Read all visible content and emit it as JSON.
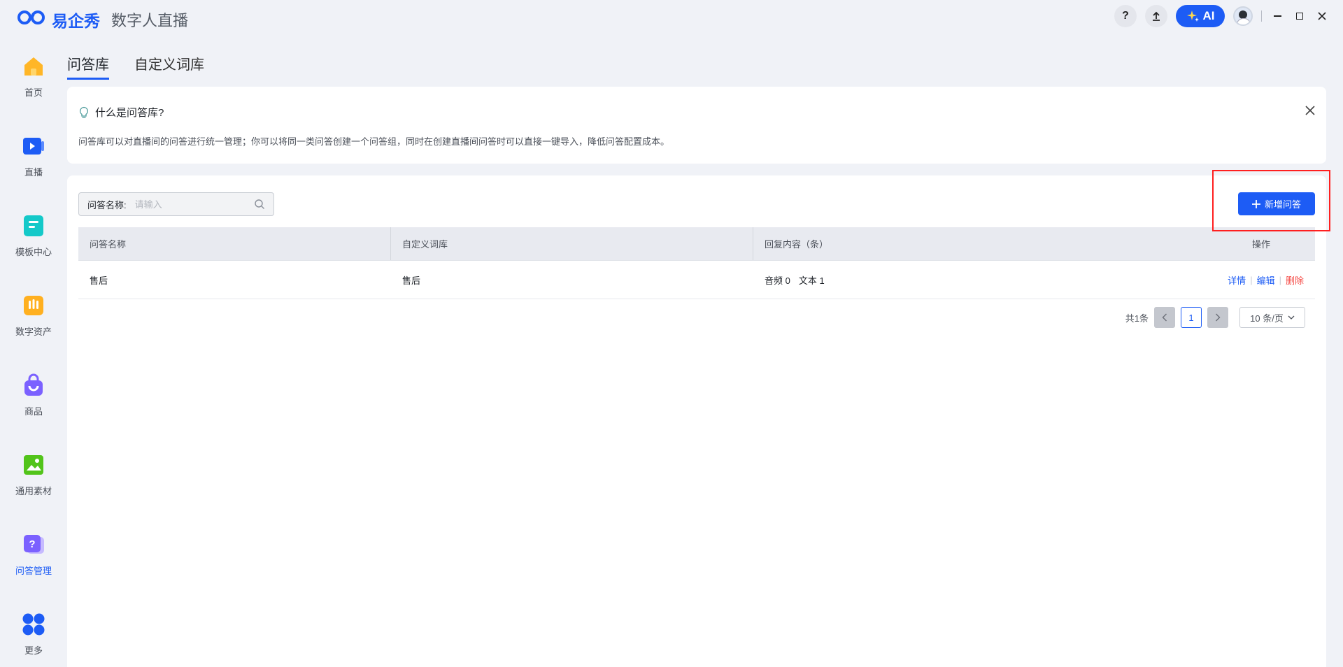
{
  "app": {
    "brand": "易企秀",
    "subtitle": "数字人直播",
    "ai_label": "AI",
    "help_label": "?"
  },
  "sidebar": {
    "items": [
      {
        "label": "首页",
        "icon": "home-icon",
        "color": "#ffb627"
      },
      {
        "label": "直播",
        "icon": "live-icon",
        "color": "#1d5cf5"
      },
      {
        "label": "模板中心",
        "icon": "template-icon",
        "color": "#14c9c9"
      },
      {
        "label": "数字资产",
        "icon": "asset-icon",
        "color": "#ffb020"
      },
      {
        "label": "商品",
        "icon": "shopping-bag-icon",
        "color": "#7b61ff"
      },
      {
        "label": "通用素材",
        "icon": "image-icon",
        "color": "#52c41a"
      },
      {
        "label": "问答管理",
        "icon": "qa-icon",
        "color": "#7b61ff",
        "active": true
      },
      {
        "label": "更多",
        "icon": "more-icon",
        "color": "#1d5cf5"
      }
    ]
  },
  "tabs": [
    {
      "label": "问答库",
      "active": true
    },
    {
      "label": "自定义词库",
      "active": false
    }
  ],
  "info": {
    "title": "什么是问答库?",
    "description": "问答库可以对直播间的问答进行统一管理；你可以将同一类问答创建一个问答组，同时在创建直播间问答时可以直接一键导入，降低问答配置成本。"
  },
  "search": {
    "label": "问答名称:",
    "placeholder": "请输入"
  },
  "toolbar": {
    "add_label": "新增问答"
  },
  "table": {
    "headers": [
      "问答名称",
      "自定义词库",
      "回复内容（条）",
      "操作"
    ],
    "rows": [
      {
        "name": "售后",
        "lexicon": "售后",
        "audio": "音频 0",
        "text": "文本 1",
        "actions": {
          "detail": "详情",
          "edit": "编辑",
          "delete": "删除"
        }
      }
    ]
  },
  "pagination": {
    "total": "共1条",
    "current": "1",
    "page_size": "10 条/页"
  },
  "colors": {
    "accent": "#1d5cf5",
    "danger": "#f54a45",
    "highlight": "#ff1f1f"
  }
}
